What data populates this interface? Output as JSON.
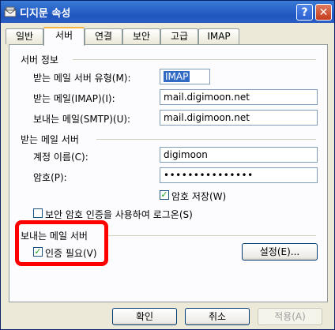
{
  "window": {
    "title": "디지문 속성"
  },
  "titlebar": {
    "help_label": "?",
    "close_label": "✕"
  },
  "tabs": [
    {
      "label": "일반"
    },
    {
      "label": "서버"
    },
    {
      "label": "연결"
    },
    {
      "label": "보안"
    },
    {
      "label": "고급"
    },
    {
      "label": "IMAP"
    }
  ],
  "server_info": {
    "group_label": "서버 정보",
    "incoming_type_label": "받는 메일 서버 유형(M):",
    "incoming_type_value": "IMAP",
    "incoming_label": "받는 메일(IMAP)(I):",
    "incoming_value": "mail.digimoon.net",
    "outgoing_label": "보내는 메일(SMTP)(U):",
    "outgoing_value": "mail.digimoon.net"
  },
  "incoming_server": {
    "group_label": "받는 메일 서버",
    "account_label": "계정 이름(C):",
    "account_value": "digimoon",
    "password_label": "암호(P):",
    "password_value": "•••••••••••••••",
    "remember_label": "암호 저장(W)",
    "remember_checked": "✓",
    "spa_label": "보안 암호 인증을 사용하여 로그온(S)"
  },
  "outgoing_server": {
    "group_label": "보내는 메일 서버",
    "auth_label": "인증 필요(V)",
    "auth_checked": "✓",
    "settings_button": "설정(E)..."
  },
  "footer": {
    "ok": "확인",
    "cancel": "취소",
    "apply": "적용(A)"
  },
  "colors": {
    "highlight": "#ff0000",
    "titlebar": "#2a64c9"
  }
}
